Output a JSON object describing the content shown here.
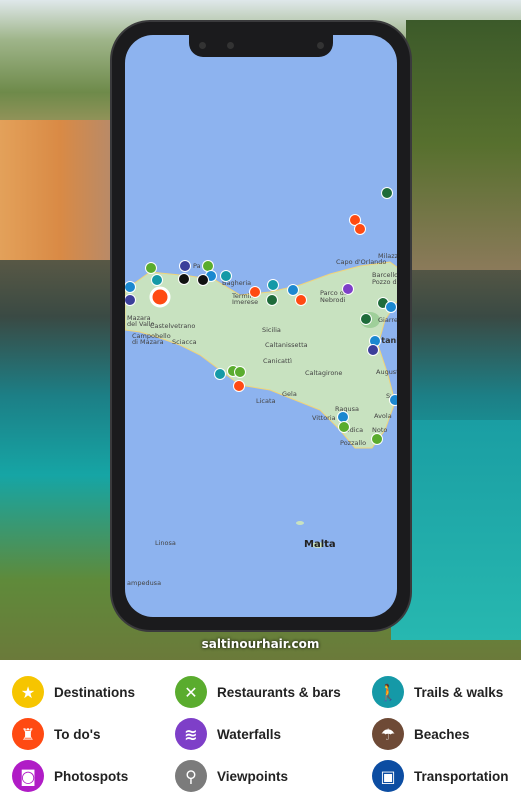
{
  "watermark": "saltinourhair.com",
  "map": {
    "labels": [
      "Capo d'Orlando",
      "Milazzo",
      "Barcellona",
      "Pozzo di Gotto",
      "Parco dei",
      "Nebrodi",
      "Termini",
      "Imerese",
      "Bagheria",
      "Pa",
      "Mazara",
      "del Vallo",
      "Castelvetrano",
      "Campobello",
      "di Mazara",
      "Sciacca",
      "Sicilia",
      "Caltanissetta",
      "Canicattì",
      "Caltagirone",
      "Catania",
      "Augusta",
      "Gela",
      "Licata",
      "Ragusa",
      "Vittoria",
      "Modica",
      "Noto",
      "Avola",
      "Pozzallo",
      "Giarre",
      "Syr",
      "Malta",
      "Linosa",
      "ampedusa"
    ]
  },
  "legend": [
    {
      "label": "Destinations",
      "icon": "star-icon",
      "color": "#f6c500",
      "glyph": "★"
    },
    {
      "label": "Restaurants & bars",
      "icon": "fork-spoon-icon",
      "color": "#5aac2e",
      "glyph": "✕"
    },
    {
      "label": "Trails & walks",
      "icon": "hiker-icon",
      "color": "#1599a7",
      "glyph": "🚶"
    },
    {
      "label": "To do's",
      "icon": "castle-icon",
      "color": "#ff4a12",
      "glyph": "♜"
    },
    {
      "label": "Waterfalls",
      "icon": "waterfall-icon",
      "color": "#7e3fc8",
      "glyph": "≋"
    },
    {
      "label": "Beaches",
      "icon": "umbrella-icon",
      "color": "#6e4a36",
      "glyph": "☂"
    },
    {
      "label": "Photospots",
      "icon": "camera-icon",
      "color": "#b01cc6",
      "glyph": "◙"
    },
    {
      "label": "Viewpoints",
      "icon": "binoculars-icon",
      "color": "#7b7b7b",
      "glyph": "⚲"
    },
    {
      "label": "Transportation",
      "icon": "train-icon",
      "color": "#0c4da2",
      "glyph": "▣"
    }
  ]
}
